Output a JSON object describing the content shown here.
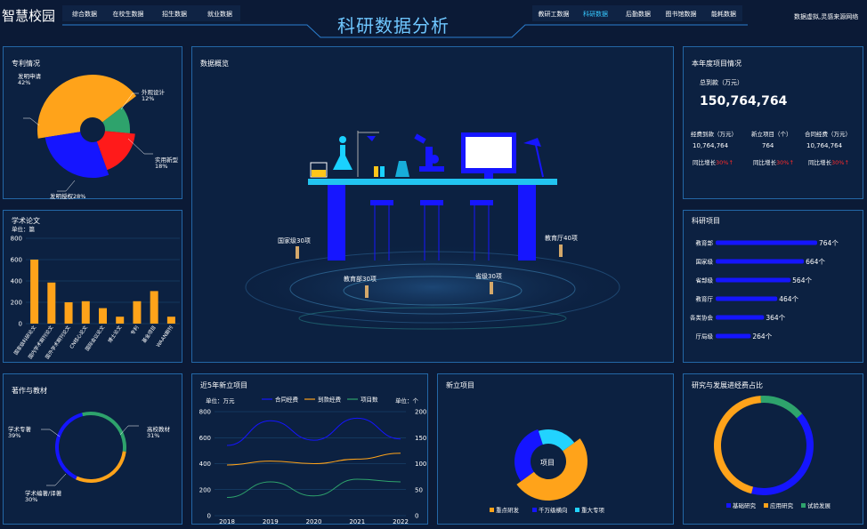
{
  "app": {
    "title": "智慧校园",
    "main_title": "科研数据分析",
    "hint": "数据虚拟,灵感来源网络",
    "left_tabs": [
      "综合数据",
      "在校生数据",
      "招生数据",
      "就业数据"
    ],
    "right_tabs": [
      "教研工数据",
      "科研数据",
      "后勤数据",
      "图书馆数据",
      "能耗数据"
    ],
    "active_tab": "科研数据"
  },
  "patent": {
    "title": "专利情况",
    "labels": [
      {
        "name": "发明申请",
        "pct": "42%"
      },
      {
        "name": "外观设计",
        "pct": "12%"
      },
      {
        "name": "实用新型",
        "pct": "18%"
      },
      {
        "name": "发明授权28%",
        "pct": ""
      }
    ]
  },
  "overview": {
    "title": "数据概览",
    "labels": [
      "国家级30项",
      "教育部30项",
      "省级30项",
      "教育厅40项"
    ]
  },
  "annual": {
    "title": "本年度项目情况",
    "total_label": "总到款（万元）",
    "total": "150,764,764",
    "cols": [
      {
        "label": "经费到款（万元）",
        "value": "10,764,764",
        "yoy_label": "同比增长",
        "yoy": "30%↑"
      },
      {
        "label": "新立项目（个）",
        "value": "764",
        "yoy_label": "同比增长",
        "yoy": "30%↑"
      },
      {
        "label": "合同经费（万元）",
        "value": "10,764,764",
        "yoy_label": "同比增长",
        "yoy": "30%↑"
      }
    ]
  },
  "papers": {
    "title": "学术论文",
    "unit": "单位：篇"
  },
  "works": {
    "title": "著作与教材",
    "labels": [
      {
        "name": "学术专著",
        "pct": "39%"
      },
      {
        "name": "高校教材",
        "pct": "31%"
      },
      {
        "name": "学术编著/译著",
        "pct": "30%"
      }
    ]
  },
  "newfive": {
    "title": "近5年新立项目",
    "unit_left": "单位：万元",
    "unit_right": "单位：个"
  },
  "newproj": {
    "title": "新立项目",
    "center": "项目"
  },
  "research": {
    "title": "科研项目"
  },
  "rnd": {
    "title": "研究与发展进经费占比"
  },
  "colors": {
    "orange": "#ffa31a",
    "blue": "#1515ff",
    "green": "#2ea36c",
    "red": "#ff1a1a",
    "cyan": "#22d3ff",
    "red_text": "#ff2b2b",
    "panel_border": "#2367a6"
  },
  "chart_data": [
    {
      "id": "patent",
      "type": "pie",
      "title": "专利情况",
      "categories": [
        "发明申请",
        "外观设计",
        "实用新型",
        "发明授权"
      ],
      "values": [
        42,
        12,
        18,
        28
      ]
    },
    {
      "id": "papers",
      "type": "bar",
      "title": "学术论文",
      "ylabel": "单位：篇",
      "ylim": [
        0,
        800
      ],
      "yticks": [
        0,
        200,
        400,
        600,
        800
      ],
      "categories": [
        "国家级科研论文",
        "国内学术期刊论文",
        "国外学术期刊论文",
        "CN核心论文",
        "国际会议论文",
        "博士论文",
        "专利",
        "基金项目",
        "WAAN期刊"
      ],
      "values": [
        600,
        385,
        200,
        210,
        145,
        65,
        210,
        305,
        65
      ]
    },
    {
      "id": "works",
      "type": "pie",
      "title": "著作与教材",
      "categories": [
        "学术专著",
        "高校教材",
        "学术编著/译著"
      ],
      "values": [
        39,
        31,
        30
      ]
    },
    {
      "id": "newfive",
      "type": "line",
      "title": "近5年新立项目",
      "x": [
        "2018",
        "2019",
        "2020",
        "2021",
        "2022"
      ],
      "ylim_left": [
        0,
        800
      ],
      "ylim_right": [
        0,
        200
      ],
      "yticks_left": [
        0,
        200,
        400,
        600,
        800
      ],
      "yticks_right": [
        0,
        50,
        100,
        150,
        200
      ],
      "series": [
        {
          "name": "合同经费",
          "axis": "left",
          "values": [
            540,
            730,
            580,
            750,
            590
          ]
        },
        {
          "name": "到款经费",
          "axis": "left",
          "values": [
            390,
            420,
            400,
            435,
            480
          ]
        },
        {
          "name": "项目数",
          "axis": "right",
          "values": [
            35,
            65,
            38,
            70,
            65
          ]
        }
      ]
    },
    {
      "id": "newproj",
      "type": "pie",
      "title": "新立项目",
      "categories": [
        "重点研发",
        "千万级横向",
        "重大专项"
      ],
      "values": [
        50,
        30,
        20
      ]
    },
    {
      "id": "research",
      "type": "bar",
      "title": "科研项目",
      "categories": [
        "教育部",
        "国家级",
        "省部级",
        "教育厅",
        "各类协会",
        "厅局级"
      ],
      "values": [
        764,
        664,
        564,
        464,
        364,
        264
      ],
      "labels": [
        "764个",
        "664个",
        "564个",
        "464个",
        "364个",
        "264个"
      ]
    },
    {
      "id": "rnd",
      "type": "pie",
      "title": "研究与发展进经费占比",
      "categories": [
        "基础研究",
        "应用研究",
        "试验发展"
      ],
      "values": [
        40,
        45,
        15
      ]
    }
  ]
}
